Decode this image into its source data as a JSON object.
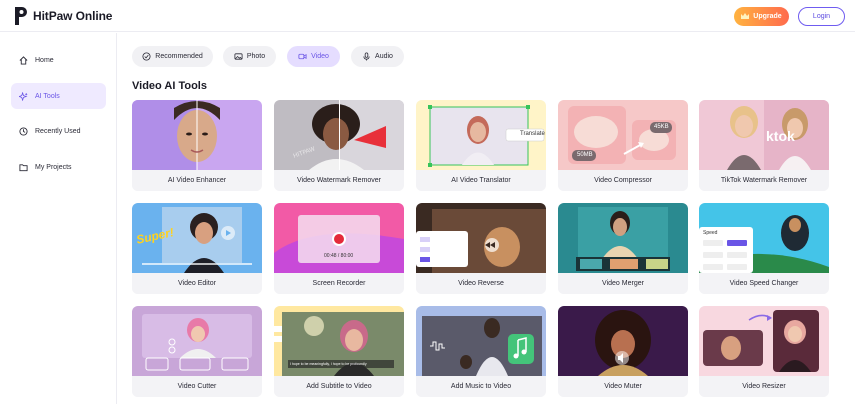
{
  "header": {
    "brand": "HitPaw Online",
    "upgrade_label": "Upgrade",
    "login_label": "Login",
    "accent": "#6a55e6"
  },
  "sidebar": {
    "items": [
      {
        "label": "Home",
        "icon": "home-icon"
      },
      {
        "label": "AI Tools",
        "icon": "sparkle-icon",
        "active": true
      },
      {
        "label": "Recently Used",
        "icon": "clock-icon"
      },
      {
        "label": "My Projects",
        "icon": "folder-icon"
      }
    ]
  },
  "tabs": [
    {
      "label": "Recommended",
      "icon": "badge-icon"
    },
    {
      "label": "Photo",
      "icon": "image-icon"
    },
    {
      "label": "Video",
      "icon": "video-icon",
      "active": true
    },
    {
      "label": "Audio",
      "icon": "microphone-icon"
    }
  ],
  "section": {
    "title": "Video AI Tools"
  },
  "tools": [
    {
      "label": "AI Video Enhancer"
    },
    {
      "label": "Video Watermark Remover"
    },
    {
      "label": "AI Video Translator"
    },
    {
      "label": "Video Compressor"
    },
    {
      "label": "TikTok Watermark Remover"
    },
    {
      "label": "Video Editor"
    },
    {
      "label": "Screen Recorder"
    },
    {
      "label": "Video Reverse"
    },
    {
      "label": "Video Merger"
    },
    {
      "label": "Video Speed Changer"
    },
    {
      "label": "Video Cutter"
    },
    {
      "label": "Add Subtitle to Video"
    },
    {
      "label": "Add Music to Video"
    },
    {
      "label": "Video Muter"
    },
    {
      "label": "Video Resizer"
    }
  ],
  "thumb_text": {
    "translate": "Translate",
    "compress_from": "50MB",
    "compress_to": "45KB",
    "tiktok": "ktok",
    "super": "Super!",
    "recorder_time": "00:48 / 80:00",
    "speed_title": "Speed",
    "subtitle_line1": "I hope to be meaningfully, I hope to be profoundly"
  }
}
